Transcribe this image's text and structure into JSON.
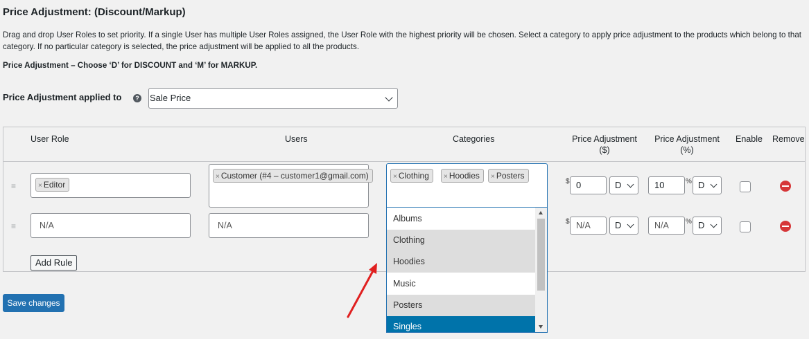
{
  "section": {
    "title": "Price Adjustment: (Discount/Markup)",
    "description": "Drag and drop User Roles to set priority. If a single User has multiple User Roles assigned, the User Role with the highest priority will be chosen. Select a category to apply price adjustment to the products which belong to that category. If no particular category is selected, the price adjustment will be applied to all the products.",
    "note": "Price Adjustment – Choose ‘D’ for DISCOUNT and ‘M’ for MARKUP."
  },
  "applied_to": {
    "label": "Price Adjustment applied to",
    "help": "?",
    "value": "Sale Price"
  },
  "table": {
    "headers": {
      "user_role": "User Role",
      "users": "Users",
      "categories": "Categories",
      "price_adj_fixed": "Price Adjustment",
      "price_adj_fixed_unit": "($)",
      "price_adj_percent": "Price Adjustment",
      "price_adj_percent_unit": "(%)",
      "enable": "Enable",
      "remove": "Remove"
    },
    "currency_symbol": "$",
    "percent_symbol": "%",
    "remove_tag": "×",
    "drag_handle": "≡",
    "rows": [
      {
        "user_role_tag": "Editor",
        "users_tag": "Customer (#4 – customer1@gmail.com)",
        "category_tags": [
          "Clothing",
          "Hoodies",
          "Posters"
        ],
        "fixed_value": "0",
        "fixed_type": "D",
        "percent_value": "10",
        "percent_type": "D",
        "enabled": false
      },
      {
        "user_role_placeholder": "N/A",
        "users_placeholder": "N/A",
        "fixed_placeholder": "N/A",
        "fixed_type": "D",
        "percent_placeholder": "N/A",
        "percent_type": "D",
        "enabled": false
      }
    ]
  },
  "category_dropdown": {
    "options": [
      "Albums",
      "Clothing",
      "Hoodies",
      "Music",
      "Posters",
      "Singles"
    ],
    "highlighted": [
      "Clothing",
      "Hoodies",
      "Posters"
    ],
    "hovered": "Singles"
  },
  "buttons": {
    "add_rule": "Add Rule",
    "save": "Save changes"
  },
  "colors": {
    "primary": "#2271b1",
    "remove": "#d63638",
    "arrow": "#e02020"
  }
}
